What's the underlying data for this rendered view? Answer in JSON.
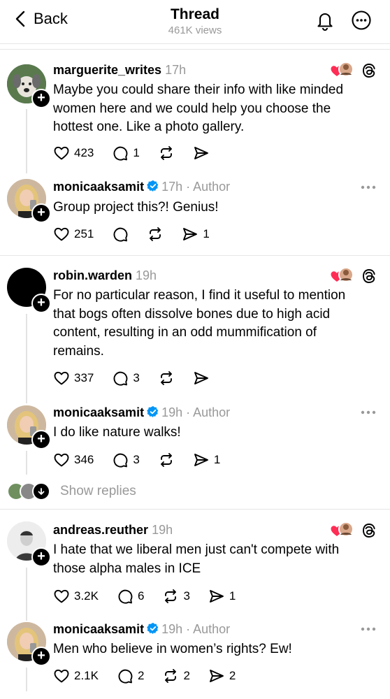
{
  "header": {
    "back_label": "Back",
    "title": "Thread",
    "views": "461K views"
  },
  "posts": [
    {
      "username": "marguerite_writes",
      "time": "17h",
      "author_tag": "",
      "text": "Maybe you could share their info with like minded women here and we could help you choose the hottest one. Like a photo gallery.",
      "likes": "423",
      "replies": "1",
      "reposts": "",
      "shares": ""
    },
    {
      "username": "monicaaksamit",
      "time": "17h",
      "author_tag": " · Author",
      "text": "Group project this?! Genius!",
      "likes": "251",
      "replies": "",
      "reposts": "",
      "shares": "1"
    },
    {
      "username": "robin.warden",
      "time": "19h",
      "author_tag": "",
      "text": "For no particular reason, I find it useful to mention that bogs often dissolve bones due to high acid content, resulting in an odd mummification of remains.",
      "likes": "337",
      "replies": "3",
      "reposts": "",
      "shares": ""
    },
    {
      "username": "monicaaksamit",
      "time": "19h",
      "author_tag": " · Author",
      "text": "I do like nature walks!",
      "likes": "346",
      "replies": "3",
      "reposts": "",
      "shares": "1"
    },
    {
      "username": "andreas.reuther",
      "time": "19h",
      "author_tag": "",
      "text": "I hate that we liberal men just can't compete with those alpha males in ICE",
      "likes": "3.2K",
      "replies": "6",
      "reposts": "3",
      "shares": "1"
    },
    {
      "username": "monicaaksamit",
      "time": "19h",
      "author_tag": " · Author",
      "text": "Men who believe in women’s rights? Ew!",
      "likes": "2.1K",
      "replies": "2",
      "reposts": "2",
      "shares": "2"
    }
  ],
  "show_replies": "Show replies",
  "colors": {
    "like_heart": "#ff2d55",
    "verified": "#0095f6",
    "muted": "#999999"
  }
}
